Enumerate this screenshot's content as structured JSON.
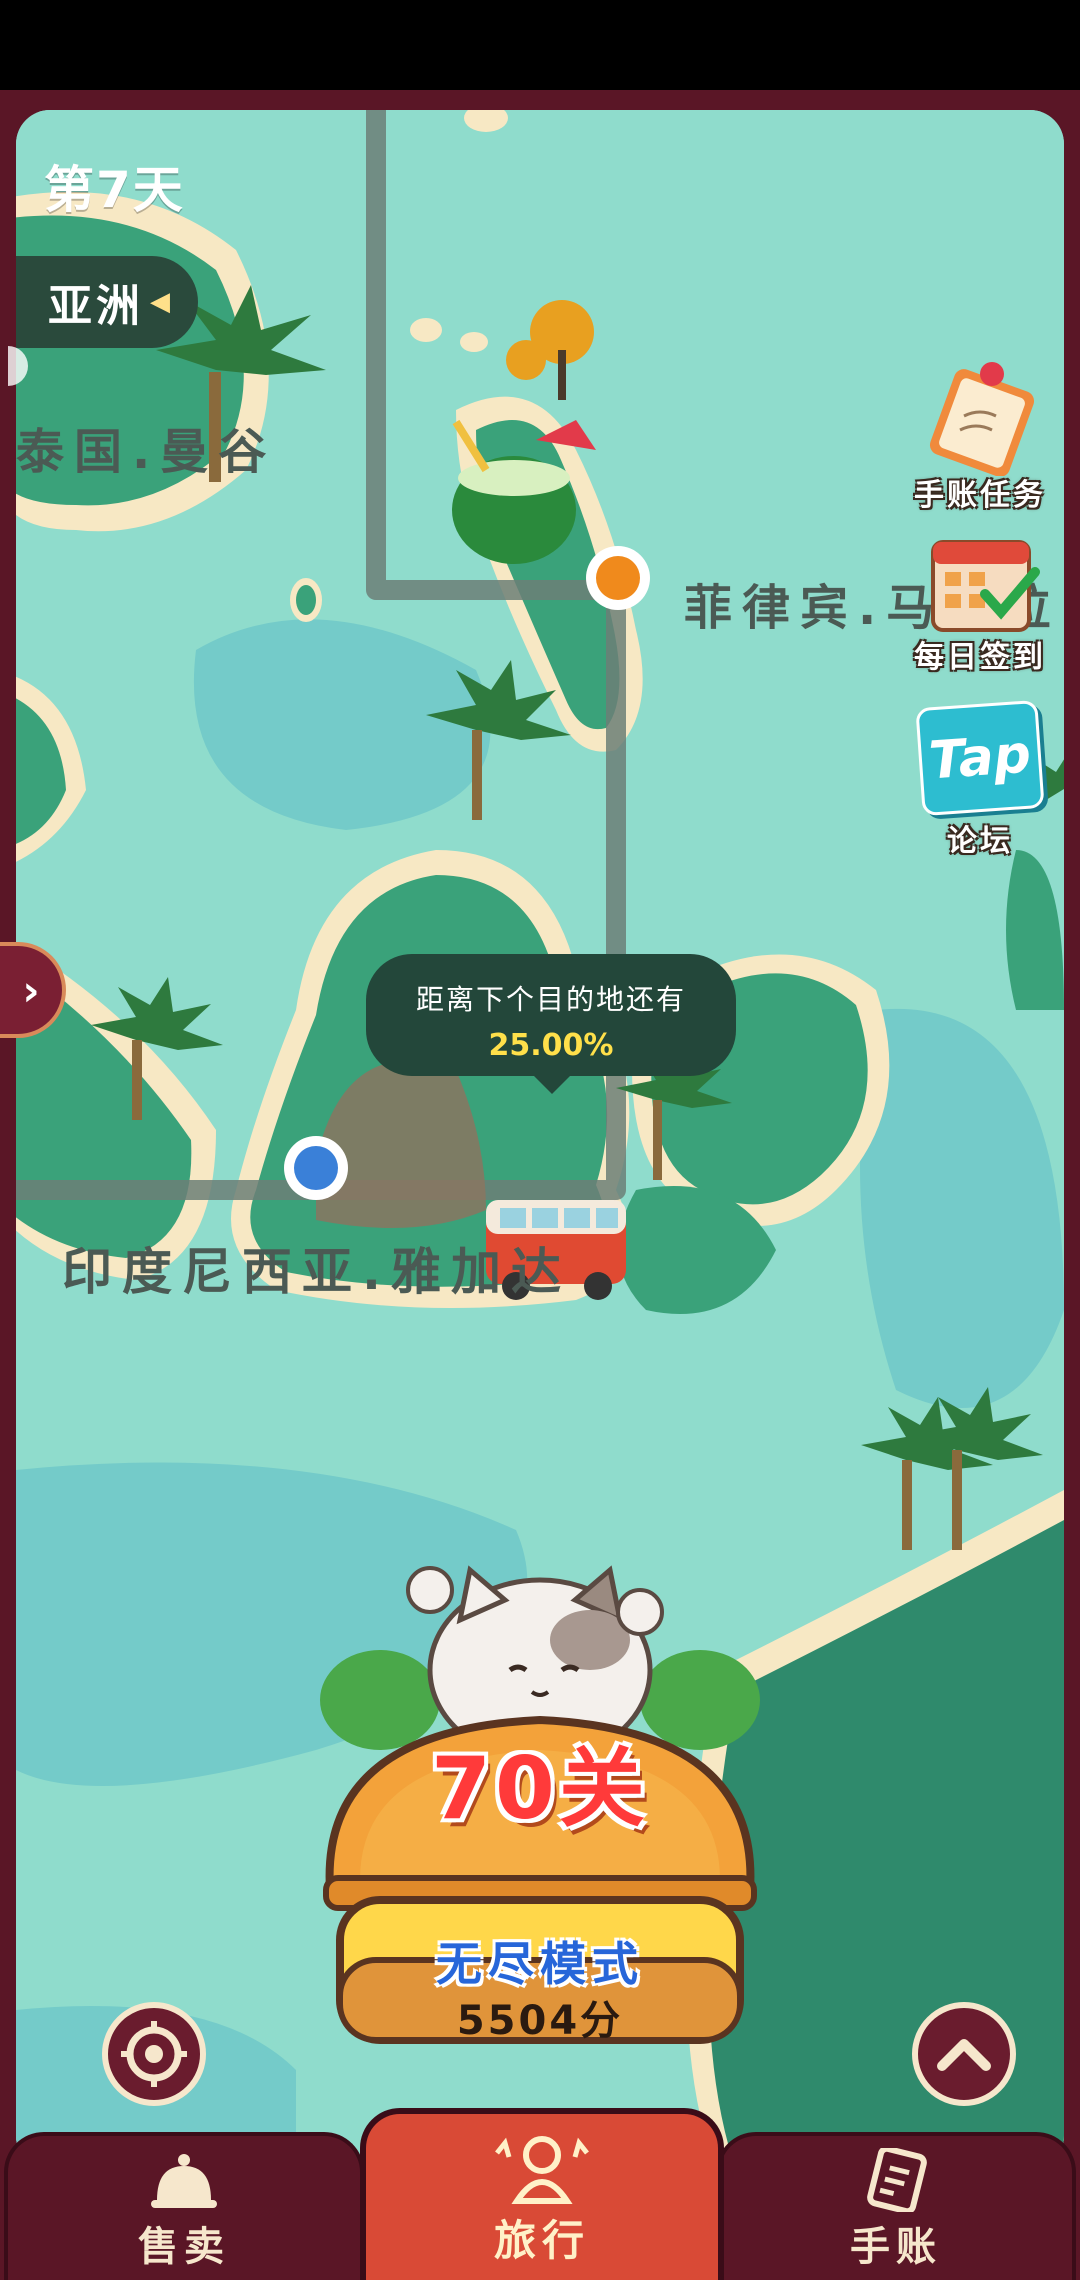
{
  "hud": {
    "day": "第7天",
    "region": "亚洲"
  },
  "map": {
    "cities": {
      "bangkok": "泰国.曼谷",
      "manila": "菲律宾.马尼拉",
      "jakarta": "印度尼西亚.雅加达"
    },
    "distance_label": "距离下个目的地还有",
    "distance_value": "25.00%",
    "progress_fraction": 0.25
  },
  "side_buttons": {
    "task": "手账任务",
    "daily": "每日签到",
    "tap_logo": "Tap",
    "forum": "论坛"
  },
  "level": {
    "title": "70关",
    "endless": "无尽模式",
    "score": "5504分"
  },
  "tabs": {
    "sell": "售卖",
    "travel": "旅行",
    "notes": "手账"
  },
  "colors": {
    "sea": "#8fdccc",
    "land": "#3aa27a",
    "frame": "#5a1626",
    "active_tab": "#d94a36"
  }
}
